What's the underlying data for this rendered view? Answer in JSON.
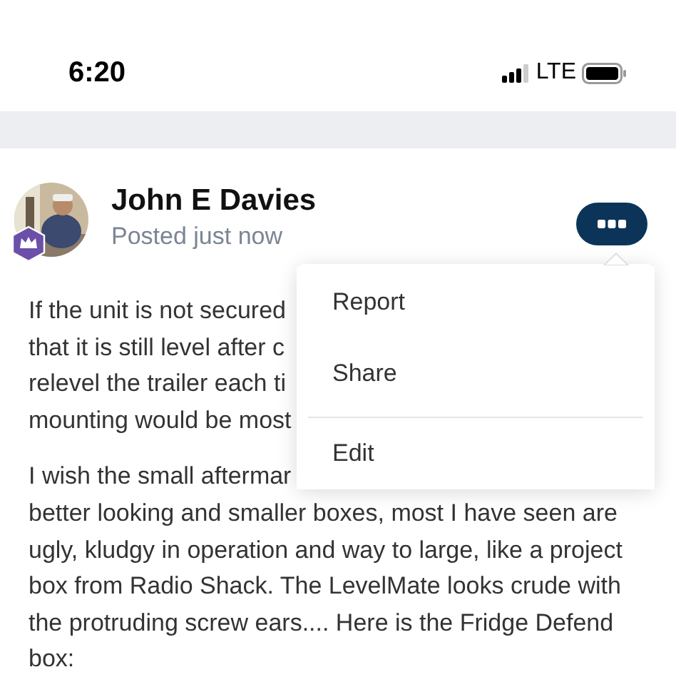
{
  "status_bar": {
    "time": "6:20",
    "network": "LTE"
  },
  "post": {
    "author": "John E Davies",
    "posted": "Posted just now",
    "paragraphs": [
      {
        "lines": [
          "If the unit is not secured",
          "that it is still level after c",
          "relevel the trailer each ti",
          "mounting would be most"
        ]
      },
      {
        "lines": [
          "I wish the small aftermar",
          "better looking and smaller boxes, most I have seen are",
          "ugly, kludgy in operation and way to large, like a project",
          "box from Radio Shack. The LevelMate looks crude with",
          "the protruding screw ears.... Here is the Fridge Defend",
          "box:"
        ]
      }
    ]
  },
  "menu": {
    "expanded": true,
    "items": [
      {
        "label": "Report",
        "divider_before": false
      },
      {
        "label": "Share",
        "divider_before": false
      },
      {
        "label": "Edit",
        "divider_before": true
      }
    ]
  }
}
